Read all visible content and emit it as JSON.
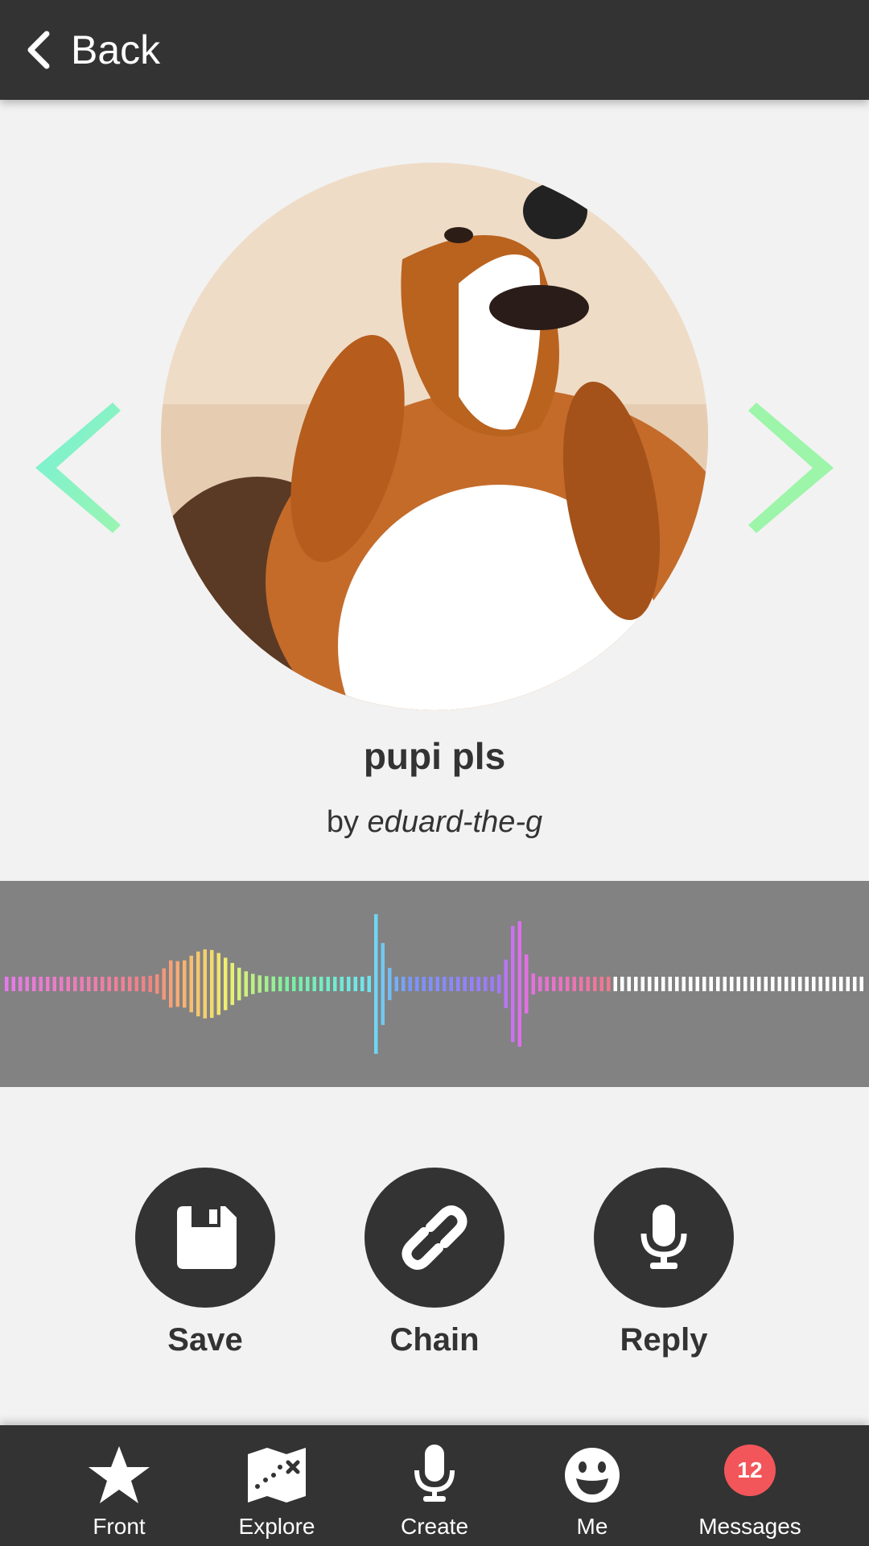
{
  "header": {
    "back_label": "Back"
  },
  "track": {
    "title": "pupi pls",
    "by_prefix": "by",
    "author": "eduard-the-g"
  },
  "actions": {
    "save": "Save",
    "chain": "Chain",
    "reply": "Reply"
  },
  "nav": {
    "front": "Front",
    "explore": "Explore",
    "create": "Create",
    "me": "Me",
    "messages": "Messages",
    "messages_badge": "12"
  },
  "colors": {
    "bar": "#333333",
    "waveform_bg": "#828282",
    "arrow_left": "#7ff5c8",
    "arrow_right": "#9cf5a8",
    "badge": "#f2565a"
  }
}
